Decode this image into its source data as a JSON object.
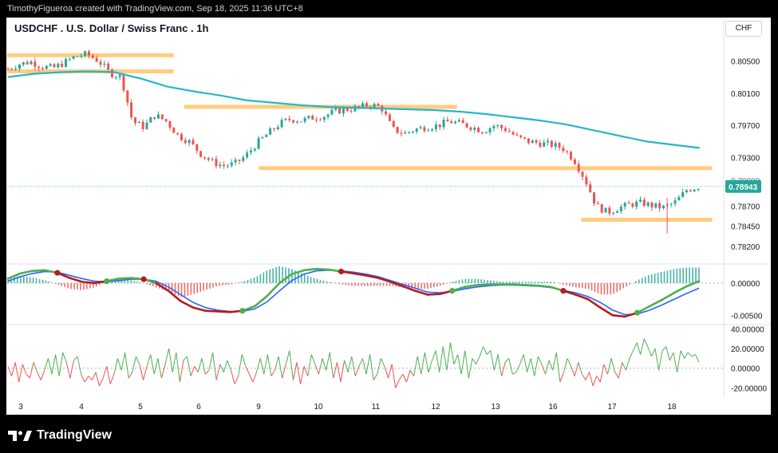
{
  "header": {
    "credit": "TimothyFigueroa created with TradingView.com, Sep 18, 2025 11:36 UTC+8"
  },
  "title": "USDCHF . U.S. Dollar / Swiss Franc . 1h",
  "currency_button": "CHF",
  "footer": {
    "brand": "TradingView",
    "logo_icon": "tradingview-logo-icon"
  },
  "colors": {
    "up": "#26a69a",
    "down": "#ef5350",
    "ma": "#26b5c9",
    "zone": "#ffcc80",
    "fast": "#4caf50",
    "slow": "#2962ff",
    "dark_red": "#b71c1c"
  },
  "chart_data": [
    {
      "type": "candlestick",
      "x": [
        "3",
        "4",
        "5",
        "6",
        "9",
        "10",
        "11",
        "12",
        "13",
        "16",
        "17",
        "18"
      ],
      "y_ticks": [
        "0.80500",
        "0.80100",
        "0.79700",
        "0.79300",
        "0.78700",
        "0.78450",
        "0.78200"
      ],
      "ylim": [
        0.7811,
        0.8078
      ],
      "last_price": "0.78943",
      "hidden_tick": "0.79000",
      "close_path": [
        0.804,
        0.8046,
        0.8049,
        0.8043,
        0.8041,
        0.8048,
        0.8056,
        0.8058,
        0.805,
        0.8035,
        0.803,
        0.7975,
        0.7968,
        0.7983,
        0.7975,
        0.7958,
        0.795,
        0.7935,
        0.7925,
        0.792,
        0.7922,
        0.7932,
        0.7948,
        0.796,
        0.7972,
        0.7978,
        0.7976,
        0.798,
        0.7982,
        0.7988,
        0.799,
        0.7992,
        0.7996,
        0.7992,
        0.7965,
        0.796,
        0.7965,
        0.7968,
        0.797,
        0.7975,
        0.7972,
        0.7968,
        0.7963,
        0.797,
        0.7965,
        0.7955,
        0.795,
        0.7948,
        0.7946,
        0.7942,
        0.7928,
        0.7903,
        0.787,
        0.7862,
        0.7868,
        0.7872,
        0.7874,
        0.787,
        0.7868,
        0.7875,
        0.789,
        0.7894
      ],
      "ma_path": [
        0.803,
        0.8034,
        0.8036,
        0.8037,
        0.8036,
        0.8028,
        0.8018,
        0.8012,
        0.8007,
        0.8001,
        0.7998,
        0.7995,
        0.7993,
        0.7992,
        0.7991,
        0.799,
        0.7989,
        0.7987,
        0.7984,
        0.798,
        0.7976,
        0.7971,
        0.7964,
        0.7957,
        0.795,
        0.7946,
        0.7942
      ],
      "zones": [
        {
          "x0": 0.0,
          "x1": 0.235,
          "y": 0.8057
        },
        {
          "x0": 0.0,
          "x1": 0.235,
          "y": 0.8037
        },
        {
          "x0": 0.25,
          "x1": 0.635,
          "y": 0.7993
        },
        {
          "x0": 0.355,
          "x1": 0.995,
          "y": 0.7917
        },
        {
          "x0": 0.81,
          "x1": 0.995,
          "y": 0.7853
        }
      ]
    },
    {
      "type": "line",
      "name": "macd",
      "y_ticks": [
        "0.00000",
        "-0.00500"
      ],
      "ylim": [
        -0.0062,
        0.0026
      ],
      "fast": [
        0.0007,
        0.0015,
        0.0019,
        0.002,
        0.0016,
        0.0008,
        0.0002,
        0.0,
        0.0003,
        0.0007,
        0.0008,
        0.0006,
        0.0,
        -0.0012,
        -0.0028,
        -0.0038,
        -0.0043,
        -0.0044,
        -0.0045,
        -0.0043,
        -0.0036,
        -0.002,
        0.0,
        0.0014,
        0.002,
        0.0022,
        0.0021,
        0.0018,
        0.0015,
        0.0012,
        0.0008,
        0.0002,
        -0.0005,
        -0.0012,
        -0.0018,
        -0.0017,
        -0.0012,
        -0.0006,
        -0.0003,
        -0.0002,
        -0.0002,
        -0.0002,
        -0.0003,
        -0.0004,
        -0.0006,
        -0.0012,
        -0.0018,
        -0.0025,
        -0.0038,
        -0.005,
        -0.0052,
        -0.0046,
        -0.0036,
        -0.0026,
        -0.0015,
        -0.0005,
        0.0003
      ],
      "slow": [
        0.0003,
        0.001,
        0.0015,
        0.0018,
        0.0017,
        0.0012,
        0.0007,
        0.0003,
        0.0002,
        0.0004,
        0.0006,
        0.0006,
        0.0003,
        -0.0006,
        -0.0018,
        -0.003,
        -0.0038,
        -0.0042,
        -0.0044,
        -0.0044,
        -0.004,
        -0.0029,
        -0.0012,
        0.0004,
        0.0014,
        0.0019,
        0.002,
        0.0019,
        0.0017,
        0.0014,
        0.001,
        0.0004,
        -0.0002,
        -0.0008,
        -0.0014,
        -0.0015,
        -0.0013,
        -0.0009,
        -0.0006,
        -0.0004,
        -0.0003,
        -0.0003,
        -0.0004,
        -0.0005,
        -0.0007,
        -0.0011,
        -0.0015,
        -0.0021,
        -0.003,
        -0.0042,
        -0.0049,
        -0.0048,
        -0.0042,
        -0.0034,
        -0.0025,
        -0.0016,
        -0.0008
      ]
    },
    {
      "type": "line",
      "name": "oscillator",
      "y_ticks": [
        "40.00000",
        "20.00000",
        "0.00000",
        "-20.00000"
      ],
      "ylim": [
        -27,
        42
      ],
      "values": [
        2,
        -8,
        6,
        -14,
        4,
        -6,
        -10,
        6,
        -4,
        -12,
        -2,
        10,
        -6,
        14,
        -8,
        16,
        6,
        -10,
        8,
        12,
        -6,
        -14,
        -8,
        -12,
        -4,
        -18,
        -10,
        2,
        -16,
        -6,
        10,
        -2,
        16,
        -10,
        -4,
        12,
        4,
        -12,
        2,
        14,
        -6,
        10,
        -10,
        4,
        20,
        -4,
        16,
        -14,
        8,
        12,
        -8,
        2,
        -4,
        10,
        -6,
        -2,
        16,
        -12,
        4,
        -4,
        8,
        -2,
        -16,
        -8,
        14,
        2,
        -6,
        -14,
        -4,
        10,
        -6,
        14,
        -8,
        -2,
        12,
        -10,
        4,
        18,
        -12,
        6,
        -16,
        2,
        -8,
        14,
        4,
        -6,
        10,
        -2,
        16,
        -10,
        6,
        -14,
        8,
        -4,
        12,
        -8,
        2,
        10,
        -6,
        14,
        -12,
        -6,
        10,
        2,
        -10,
        4,
        -20,
        -12,
        -6,
        -14,
        -2,
        -8,
        12,
        -6,
        16,
        -4,
        8,
        18,
        -4,
        22,
        -2,
        26,
        4,
        14,
        -6,
        18,
        -10,
        10,
        4,
        12,
        22,
        14,
        18,
        -2,
        14,
        -8,
        6,
        10,
        -6,
        -4,
        4,
        14,
        -4,
        10,
        -8,
        12,
        4,
        -6,
        8,
        -2,
        16,
        -14,
        -4,
        10,
        2,
        -8,
        6,
        -6,
        -12,
        -4,
        -18,
        -8,
        -14,
        4,
        -6,
        10,
        -4,
        -10,
        6,
        -2,
        10,
        18,
        26,
        14,
        30,
        22,
        12,
        20,
        -2,
        18,
        22,
        8,
        16,
        -4,
        18,
        10,
        16,
        12,
        14,
        6
      ]
    }
  ]
}
